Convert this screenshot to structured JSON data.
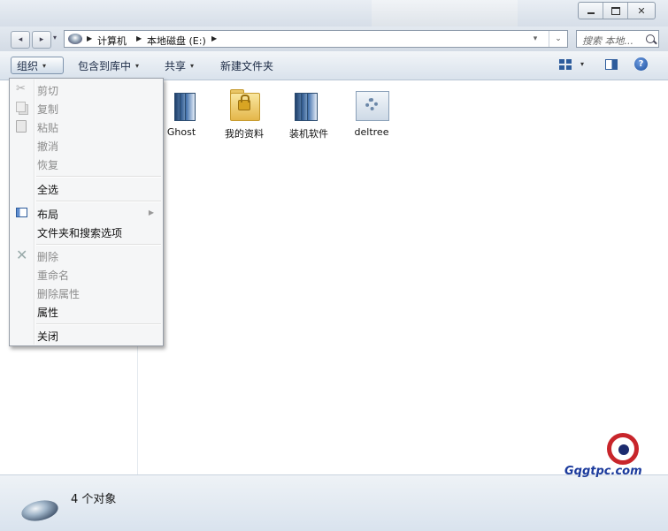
{
  "window": {
    "controls": {
      "minimize": "▭",
      "maximize": "□",
      "close": "✕"
    }
  },
  "address": {
    "crumbs": [
      "计算机",
      "本地磁盘 (E:)"
    ],
    "search_placeholder": "搜索 本地..."
  },
  "toolbar": {
    "organize": "组织",
    "include_library": "包含到库中",
    "share": "共享",
    "new_folder": "新建文件夹"
  },
  "files": [
    {
      "label": "Ghost",
      "icon": "stacked-folder-icon"
    },
    {
      "label": "我的资料",
      "icon": "locked-folder-icon"
    },
    {
      "label": "装机软件",
      "icon": "stacked-folder-icon"
    },
    {
      "label": "deltree",
      "icon": "gear-file-icon"
    }
  ],
  "menu": {
    "cut": "剪切",
    "copy": "复制",
    "paste": "粘贴",
    "undo": "撤消",
    "redo": "恢复",
    "select_all": "全选",
    "layout": "布局",
    "folder_options": "文件夹和搜索选项",
    "delete": "删除",
    "rename": "重命名",
    "remove_properties": "删除属性",
    "properties": "属性",
    "close": "关闭"
  },
  "status": {
    "count": "4 个对象"
  },
  "watermark": {
    "text": "Gqgtpc.com"
  },
  "colors": {
    "accent": "#2d5c9c",
    "watermark_red": "#c8252b",
    "watermark_blue": "#1b3a9c"
  }
}
